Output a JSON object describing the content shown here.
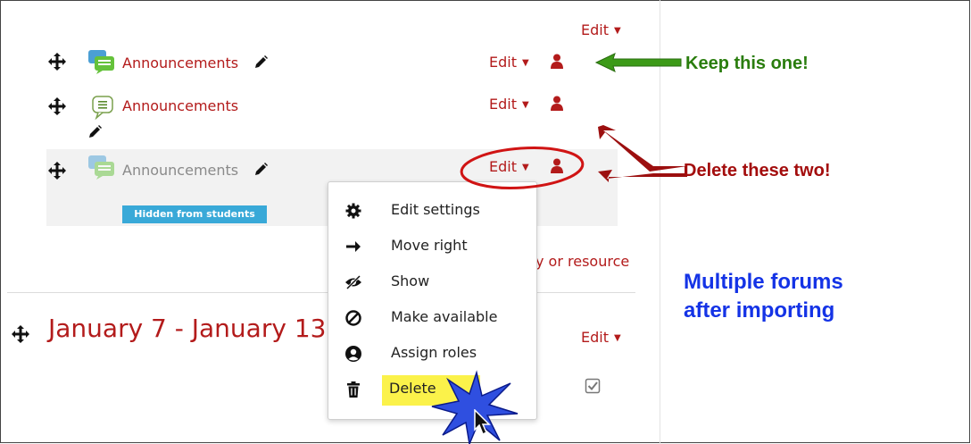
{
  "section_edit": {
    "label": "Edit"
  },
  "activities": [
    {
      "name": "Announcements",
      "edit": "Edit"
    },
    {
      "name": "Announcements",
      "edit": "Edit"
    },
    {
      "name": "Announcements",
      "edit": "Edit",
      "badge": "Hidden from students"
    }
  ],
  "add_activity": {
    "label": "y or resource"
  },
  "next_section": {
    "title": "January 7 - January 13",
    "edit": "Edit"
  },
  "menu": {
    "items": [
      {
        "label": "Edit settings",
        "icon": "gear-icon"
      },
      {
        "label": "Move right",
        "icon": "arrow-right-icon"
      },
      {
        "label": "Show",
        "icon": "eye-slash-icon"
      },
      {
        "label": "Make available",
        "icon": "ban-icon"
      },
      {
        "label": "Assign roles",
        "icon": "user-circle-icon"
      },
      {
        "label": "Delete",
        "icon": "trash-icon"
      }
    ]
  },
  "annotations": {
    "keep": "Keep this one!",
    "delete": "Delete these two!",
    "note_line1": "Multiple forums",
    "note_line2": "after importing"
  },
  "colors": {
    "accent_red": "#b31b1b",
    "badge_blue": "#39a9d8",
    "keep_green": "#2a7d0e",
    "delete_red": "#a30d0d",
    "note_blue": "#1433e6",
    "highlight_yellow": "#fbf24a"
  }
}
